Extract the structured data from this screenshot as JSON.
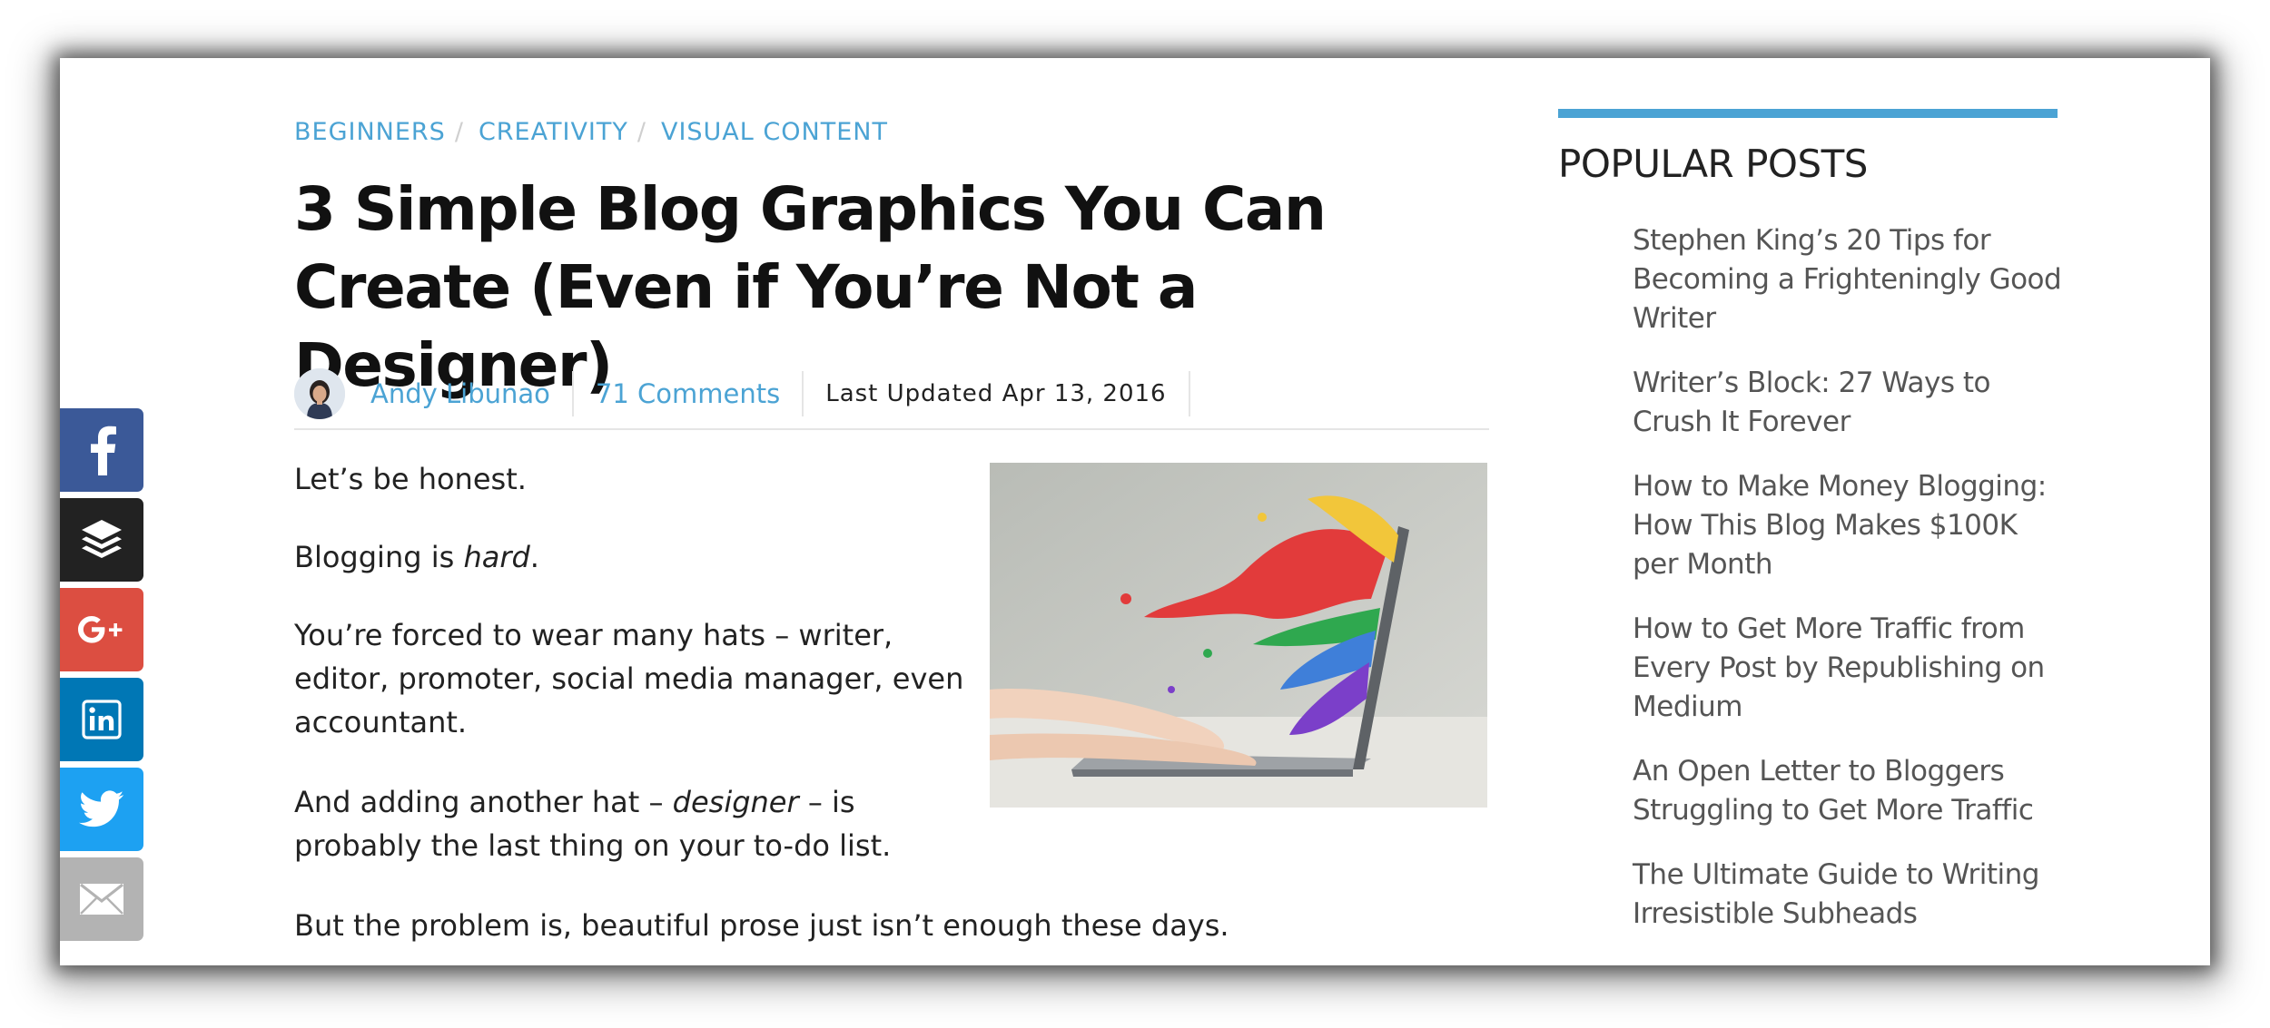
{
  "breadcrumbs": [
    "BEGINNERS",
    "CREATIVITY",
    "VISUAL CONTENT"
  ],
  "breadcrumb_separator": "/",
  "article": {
    "title": "3 Simple Blog Graphics You Can Create (Even if You’re Not a Designer)",
    "author": "Andy Libunao",
    "comments": "71 Comments",
    "updated": "Last Updated Apr 13, 2016",
    "p1": "Let’s be honest.",
    "p2_pre": "Blogging is ",
    "p2_em": "hard",
    "p2_post": ".",
    "p3": "You’re forced to wear many hats – writer, editor, promoter, social media manager, even accountant.",
    "p4_pre": "And adding another hat – ",
    "p4_em": "designer",
    "p4_post": " – is probably the last thing on your to-do list.",
    "p5": "But the problem is, beautiful prose just isn’t enough these days."
  },
  "social": [
    "facebook-icon",
    "buffer-icon",
    "google-plus-icon",
    "linkedin-icon",
    "twitter-icon",
    "email-icon"
  ],
  "colors": {
    "accent": "#4ba3d4",
    "facebook": "#3b5998",
    "buffer": "#222222",
    "google_plus": "#dc4e41",
    "linkedin": "#0077b5",
    "twitter": "#1da1f2",
    "email": "#b3b3b3"
  },
  "sidebar": {
    "title": "POPULAR POSTS",
    "posts": [
      "Stephen King’s 20 Tips for Becoming a Frighteningly Good Writer",
      "Writer’s Block: 27 Ways to Crush It Forever",
      "How to Make Money Blogging: How This Blog Makes $100K per Month",
      "How to Get More Traffic from Every Post by Republishing on Medium",
      "An Open Letter to Bloggers Struggling to Get More Traffic",
      "The Ultimate Guide to Writing Irresistible Subheads"
    ]
  }
}
